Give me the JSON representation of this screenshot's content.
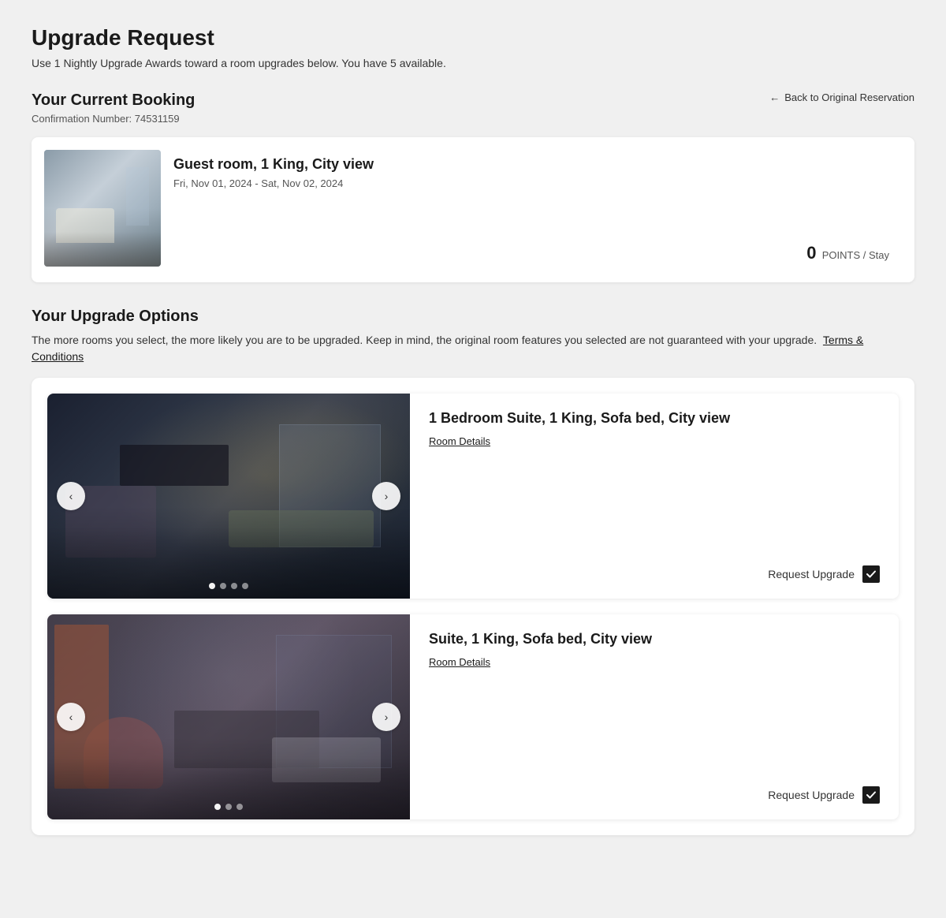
{
  "page": {
    "title": "Upgrade Request",
    "subtitle": "Use 1 Nightly Upgrade Awards toward a room upgrades below. You have 5 available."
  },
  "current_booking": {
    "section_title": "Your Current Booking",
    "back_link": "Back to Original Reservation",
    "confirmation_label": "Confirmation Number: 74531159",
    "room_name": "Guest room, 1 King, City view",
    "dates": "Fri, Nov 01, 2024 - Sat, Nov 02, 2024",
    "points_value": "0",
    "points_label": "POINTS / Stay"
  },
  "upgrade_options": {
    "section_title": "Your Upgrade Options",
    "description": "The more rooms you select, the more likely you are to be upgraded. Keep in mind, the original room features you selected are not guaranteed with your upgrade.",
    "terms_link": "Terms & Conditions",
    "rooms": [
      {
        "name": "1 Bedroom Suite, 1 King, Sofa bed, City view",
        "room_details_link": "Room Details",
        "request_upgrade_label": "Request Upgrade",
        "checked": true,
        "dots": [
          true,
          false,
          false,
          false
        ],
        "image_class": "room-img-1"
      },
      {
        "name": "Suite, 1 King, Sofa bed, City view",
        "room_details_link": "Room Details",
        "request_upgrade_label": "Request Upgrade",
        "checked": true,
        "dots": [
          true,
          false,
          false
        ],
        "image_class": "room-img-2"
      }
    ]
  },
  "icons": {
    "arrow_left": "←",
    "arrow_right": "→",
    "chevron_left": "‹",
    "chevron_right": "›"
  }
}
